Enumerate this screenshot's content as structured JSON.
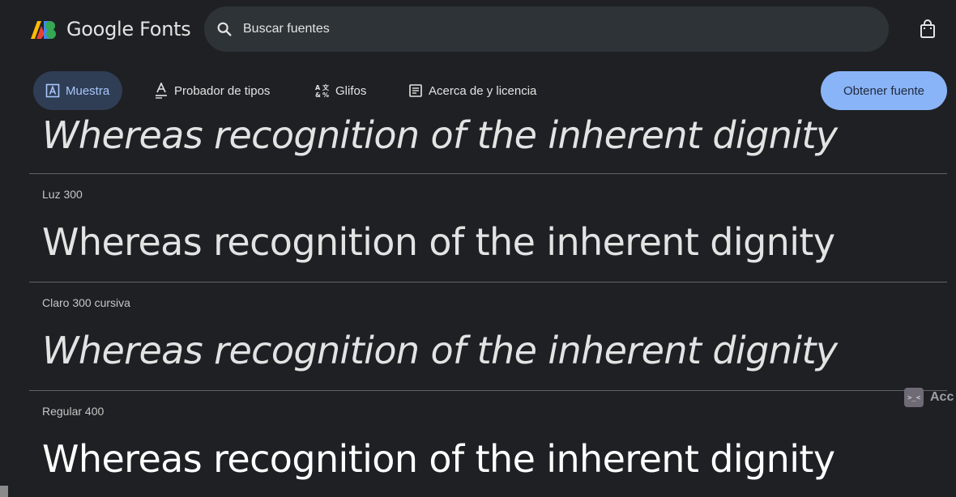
{
  "header": {
    "logo_text": "Google Fonts",
    "search_placeholder": "Buscar fuentes",
    "icons": {
      "search": "search-icon",
      "cart": "shopping-bag-icon"
    }
  },
  "tabs": [
    {
      "label": "Muestra",
      "icon": "specimen-icon",
      "active": true
    },
    {
      "label": "Probador de tipos",
      "icon": "type-tester-icon",
      "active": false
    },
    {
      "label": "Glifos",
      "icon": "glyphs-icon",
      "active": false
    },
    {
      "label": "Acerca de y licencia",
      "icon": "about-icon",
      "active": false
    }
  ],
  "get_font_label": "Obtener fuente",
  "specimens": [
    {
      "label": "",
      "sample": "Whereas recognition of the inherent dignity"
    },
    {
      "label": "Luz 300",
      "sample": "Whereas recognition of the inherent dignity"
    },
    {
      "label": "Claro 300 cursiva",
      "sample": "Whereas recognition of the inherent dignity"
    },
    {
      "label": "Regular 400",
      "sample": "Whereas recognition of the inherent dignity"
    }
  ],
  "side_overlay": {
    "label": "Acc"
  },
  "colors": {
    "background": "#1f2023",
    "active_tab_bg": "#2f3d55",
    "active_tab_text": "#a8c7fa",
    "primary_button": "#8ab4f8"
  }
}
